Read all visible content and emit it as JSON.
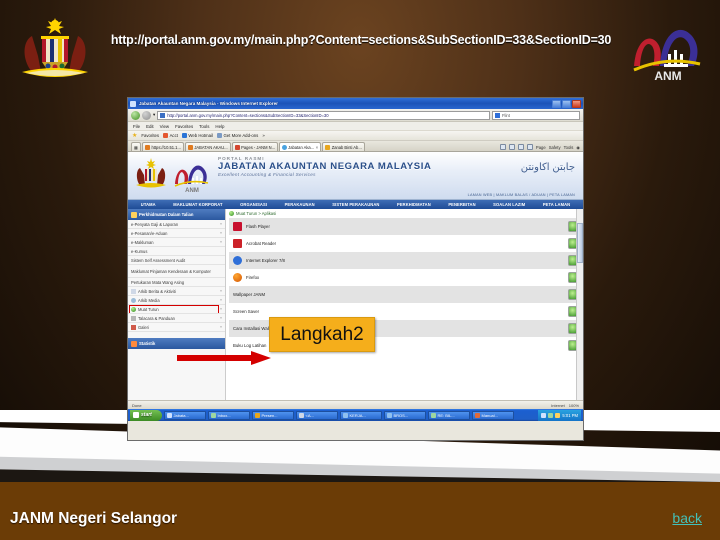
{
  "slide": {
    "header_url": "http://portal.anm.gov.my/main.php?Content=sections&SubSectionID=33&SectionID=30",
    "footer_title": "JANM Negeri Selangor",
    "back_link": "back",
    "emblem_name": "Jata Negara Malaysia",
    "logo_name": "ANM",
    "callout_label": "Langkah2",
    "accent_callout": "#f5ae1b",
    "accent_band": "#6b3c06",
    "accent_link": "#43c0b8"
  },
  "browser": {
    "title": "Jabatan Akauntan Negara Malaysia - Windows Internet Explorer",
    "address_value": "http://portal.anm.gov.my/main.php?Content=sections&SubSectionID=33&SectionID=30",
    "search_placeholder": "Flint",
    "menu": [
      "File",
      "Edit",
      "View",
      "Favorites",
      "Tools",
      "Help"
    ],
    "favorites_label": "Favorites",
    "favorites": [
      "Acct",
      "Web Hotmail",
      "Get More Add-ons"
    ],
    "tabs": [
      {
        "label": "https://10.51.1...",
        "active": false
      },
      {
        "label": "JABATAN AKAU...",
        "active": false
      },
      {
        "label": "Pages - JANM N...",
        "active": false
      },
      {
        "label": "Jabatan Aka...",
        "active": true
      },
      {
        "label": "Zanab Binti Ab...",
        "active": false
      }
    ],
    "tab_tools": [
      "Page",
      "Safety",
      "Tools"
    ],
    "status_text": "Done",
    "status_zone": "Internet",
    "status_zoom": "100%",
    "window_buttons": [
      "minimize",
      "maximize",
      "close"
    ]
  },
  "site": {
    "portal_kicker": "PORTAL RASMI",
    "portal_title": "JABATAN AKAUNTAN NEGARA MALAYSIA",
    "portal_tagline": "Excellent Accounting & Financial Services",
    "jawi": "جابتن اكاونتن",
    "top_links": "LAMAN WEB  |  MAKLUM BALAS / ADUAN  |  PETA LAMAN",
    "nav": [
      "UTAMA",
      "MAKLUMAT KORPORAT",
      "ORGANISASI",
      "PERAKAUNAN",
      "SISTEM PERAKAUNAN",
      "PERKHIDMATAN",
      "PENERBITAN",
      "SOALAN LAZIM",
      "PETA LAMAN"
    ]
  },
  "sidebar": {
    "header": "Perkhidmatan Dalam Talian",
    "statistik": "Statistik",
    "items": [
      {
        "label": "e-Penyata Gaji & Laporan",
        "arrow": "»",
        "highlight": false
      },
      {
        "label": "e-Pesanan/e-Aduan",
        "arrow": "»",
        "highlight": false
      },
      {
        "label": "e-Makluman",
        "arrow": "»",
        "highlight": false
      },
      {
        "label": "e-Kumus",
        "arrow": "",
        "highlight": false
      },
      {
        "label": "Sistem Self Assessment Audit",
        "arrow": "",
        "highlight": false
      },
      {
        "label": "Maklumat Pinjaman Kenderaan & Komputer",
        "arrow": "",
        "highlight": false
      },
      {
        "label": "Pertukaran Mata Wang Asing",
        "arrow": "",
        "highlight": false
      },
      {
        "label": "Arkib Berita & Aktiviti",
        "arrow": "»",
        "highlight": false
      },
      {
        "label": "Arkib Media",
        "arrow": "»",
        "highlight": false
      },
      {
        "label": "Muat Turun",
        "arrow": "»",
        "highlight": true
      },
      {
        "label": "Talacara & Panduan",
        "arrow": "»",
        "highlight": false
      },
      {
        "label": "Galeri",
        "arrow": "»",
        "highlight": false
      }
    ]
  },
  "main": {
    "breadcrumb": "Muat Turun > Aplikasi",
    "downloads": [
      {
        "name": "Flash Player"
      },
      {
        "name": "Acrobat Reader"
      },
      {
        "name": "Internet Explorer 7/8"
      },
      {
        "name": "Firefox"
      },
      {
        "name": "Wallpaper JANM"
      },
      {
        "name": "Screen Saver"
      },
      {
        "name": "Cara Installasi Wallpaper dan Screen Saver JANM"
      },
      {
        "name": "Buku Log Latihan"
      }
    ]
  },
  "taskbar": {
    "start_label": "start",
    "clock": "5:01 PM",
    "buttons": [
      {
        "label": "Jabata..."
      },
      {
        "label": "Inbox..."
      },
      {
        "label": "Presen..."
      },
      {
        "label": "<A..."
      },
      {
        "label": "KERJA..."
      },
      {
        "label": "BROS..."
      },
      {
        "label": "RE: BIL..."
      },
      {
        "label": "Manual..."
      }
    ]
  }
}
